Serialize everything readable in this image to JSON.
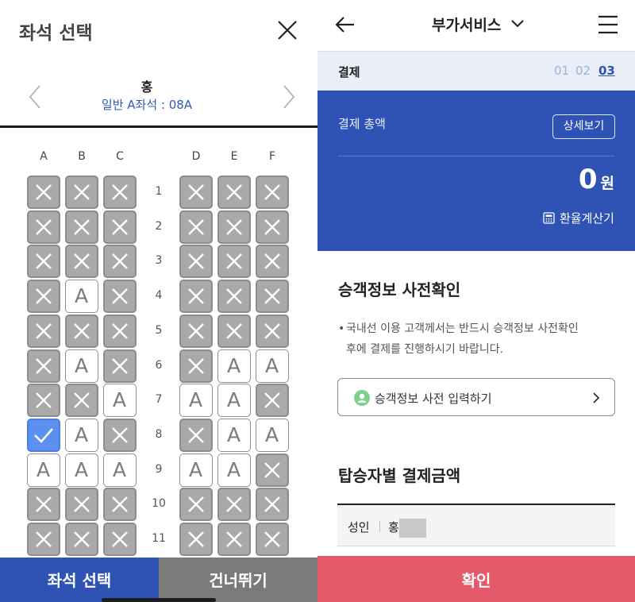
{
  "seat_panel": {
    "title": "좌석 선택",
    "passenger_name": "홍",
    "passenger_seat": "일반 A좌석 : 08A",
    "columns": [
      "A",
      "B",
      "C",
      "D",
      "E",
      "F"
    ],
    "rows": [
      {
        "label": "1",
        "seats": [
          "taken",
          "taken",
          "taken",
          "taken",
          "taken",
          "taken"
        ]
      },
      {
        "label": "2",
        "seats": [
          "taken",
          "taken",
          "taken",
          "taken",
          "taken",
          "taken"
        ]
      },
      {
        "label": "3",
        "seats": [
          "taken",
          "taken",
          "taken",
          "taken",
          "taken",
          "taken"
        ]
      },
      {
        "label": "4",
        "seats": [
          "taken",
          "open",
          "taken",
          "taken",
          "taken",
          "taken"
        ]
      },
      {
        "label": "5",
        "seats": [
          "taken",
          "taken",
          "taken",
          "taken",
          "taken",
          "taken"
        ]
      },
      {
        "label": "6",
        "seats": [
          "taken",
          "open",
          "taken",
          "taken",
          "open",
          "open"
        ]
      },
      {
        "label": "7",
        "seats": [
          "taken",
          "taken",
          "open",
          "open",
          "open",
          "taken"
        ]
      },
      {
        "label": "8",
        "seats": [
          "selected",
          "open",
          "taken",
          "taken",
          "open",
          "open"
        ]
      },
      {
        "label": "9",
        "seats": [
          "open",
          "open",
          "open",
          "open",
          "open",
          "taken"
        ]
      },
      {
        "label": "10",
        "seats": [
          "taken",
          "taken",
          "taken",
          "taken",
          "taken",
          "taken"
        ]
      },
      {
        "label": "11",
        "seats": [
          "taken",
          "taken",
          "taken",
          "taken",
          "taken",
          "taken"
        ]
      }
    ],
    "open_seat_glyph": "A",
    "select_button": "좌석 선택",
    "skip_button": "건너뛰기",
    "colors": {
      "selected": "#5b8ff0",
      "taken": "#a9a9a9",
      "select_btn": "#2f53b4",
      "skip_btn": "#7a7a7a"
    }
  },
  "payment_panel": {
    "header_title": "부가서비스",
    "step_label": "결제",
    "steps": [
      "01",
      "02",
      "03"
    ],
    "active_step": "03",
    "total_label": "결제 총액",
    "detail_button": "상세보기",
    "amount": "0",
    "currency": "원",
    "fx_calculator": "환율계산기",
    "precheck_title": "승객정보 사전확인",
    "notice_bullet": "•",
    "notice_line1": "국내선 이용 고객께서는 반드시 승객정보 사전확인",
    "notice_line2": "후에 결제를 진행하시기 바랍니다.",
    "precheck_button": "승객정보 사전 입력하기",
    "fare_title": "탑승자별 결제금액",
    "fare_type": "성인",
    "fare_name": "홍",
    "confirm_button": "확인",
    "colors": {
      "brand": "#2f53b4",
      "confirm": "#e55a6a",
      "step_bar": "#e9eef7"
    }
  },
  "icons": [
    "close-icon",
    "chevron-left-icon",
    "chevron-right-icon",
    "back-arrow-icon",
    "chevron-down-icon",
    "hamburger-icon",
    "calculator-icon",
    "person-icon"
  ]
}
